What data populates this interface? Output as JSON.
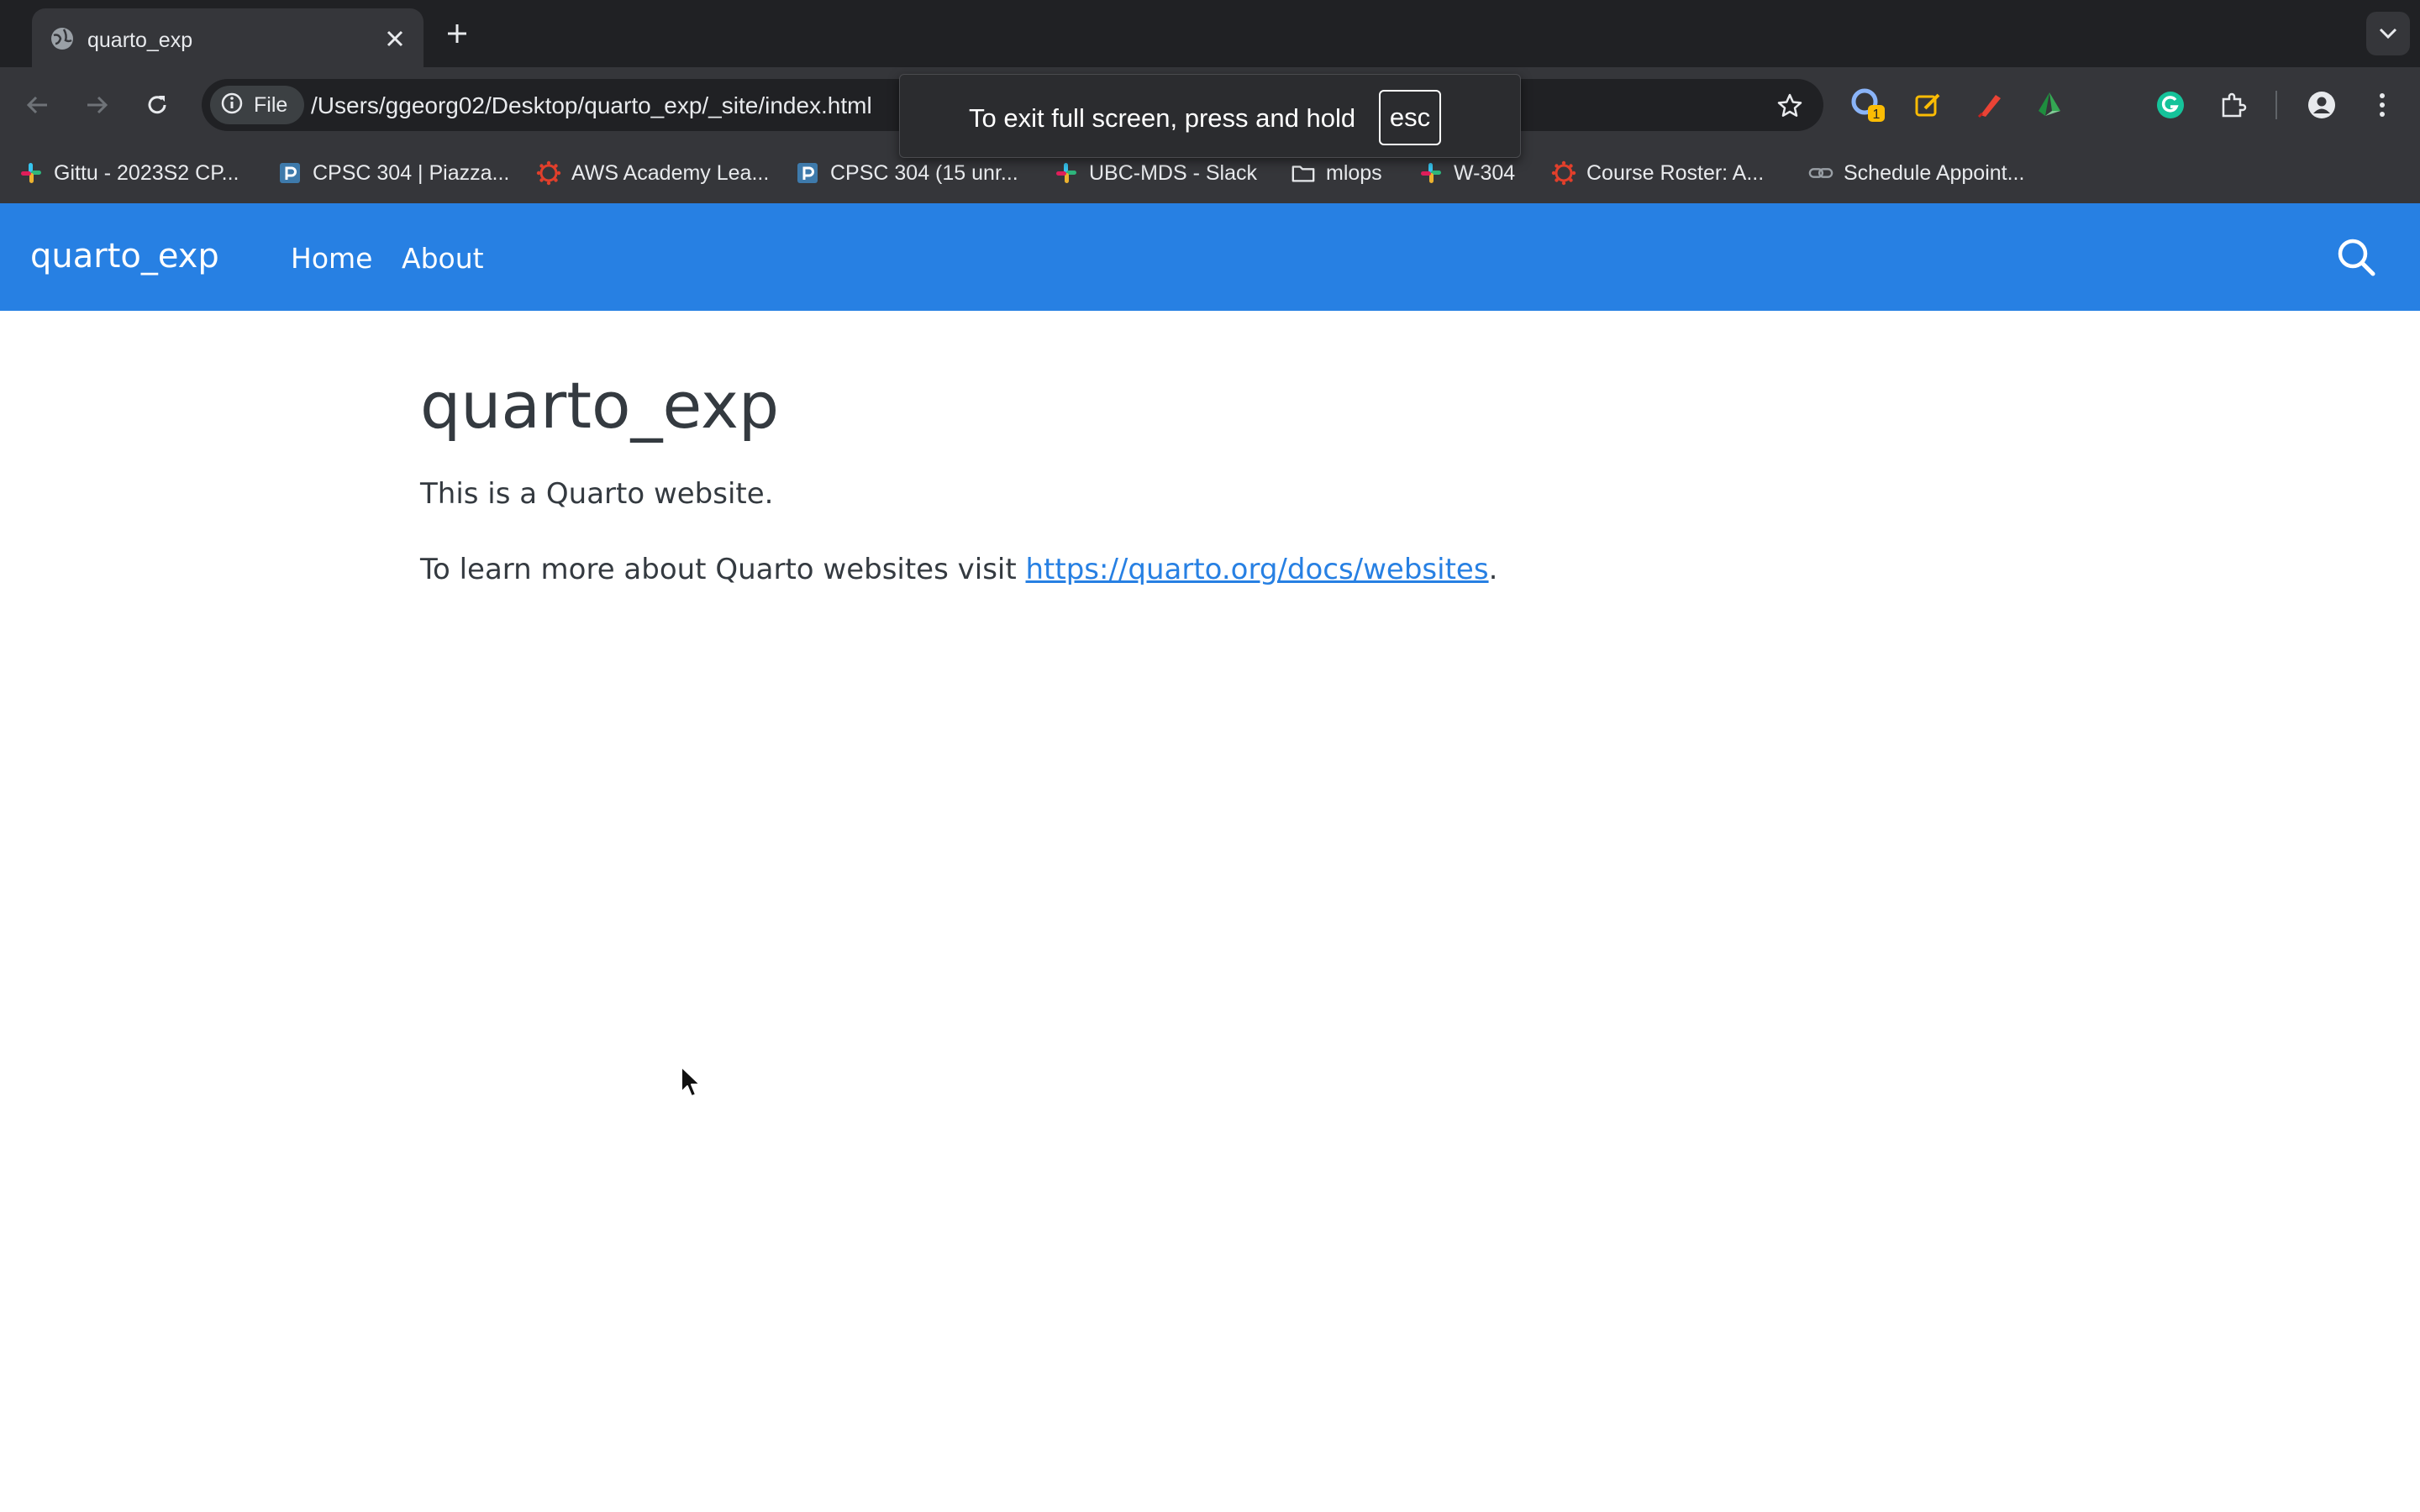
{
  "browser": {
    "tab": {
      "title": "quarto_exp"
    },
    "omnibox": {
      "chip_label": "File",
      "url": "/Users/ggeorg02/Desktop/quarto_exp/_site/index.html"
    },
    "extensions": [
      {
        "name": "extension-badge-icon",
        "badge": "1",
        "color": "#fbbc04"
      },
      {
        "name": "note-edit-extension-icon",
        "color": "#fbbc04"
      },
      {
        "name": "marker-extension-icon",
        "color": "#ea4335"
      },
      {
        "name": "drive-extension-icon",
        "color": "#34a853"
      },
      {
        "name": "grammarly-icon",
        "color": "#15c39a"
      }
    ],
    "bookmarks": [
      {
        "label": "Gittu - 2023S2 CP...",
        "icon": "slack-icon"
      },
      {
        "label": "CPSC 304 | Piazza...",
        "icon": "piazza-icon"
      },
      {
        "label": "AWS Academy Lea...",
        "icon": "canvas-icon"
      },
      {
        "label": "CPSC 304 (15 unr...",
        "icon": "piazza-icon"
      },
      {
        "label": "UBC-MDS - Slack",
        "icon": "slack-icon"
      },
      {
        "label": "mlops",
        "icon": "folder-icon"
      },
      {
        "label": "W-304",
        "icon": "slack-icon"
      },
      {
        "label": "Course Roster: A...",
        "icon": "canvas-icon"
      },
      {
        "label": "Schedule Appoint...",
        "icon": "link-icon"
      }
    ]
  },
  "fullscreen_toast": {
    "text": "To exit full screen, press and hold",
    "key": "esc"
  },
  "site": {
    "brand": "quarto_exp",
    "nav": [
      {
        "label": "Home"
      },
      {
        "label": "About"
      }
    ],
    "accent_color": "#2780e3",
    "page_title": "quarto_exp",
    "paragraph1": "This is a Quarto website.",
    "paragraph2_prefix": "To learn more about Quarto websites visit ",
    "paragraph2_link": "https://quarto.org/docs/websites",
    "paragraph2_suffix": "."
  }
}
